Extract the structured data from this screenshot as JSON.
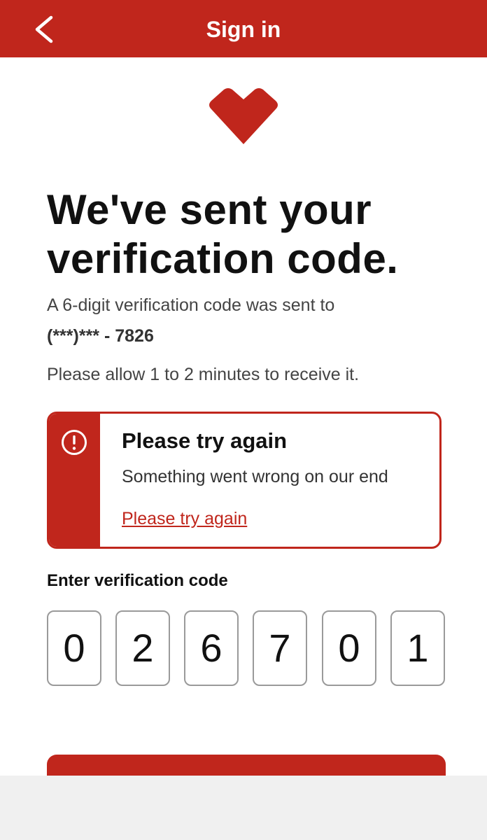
{
  "header": {
    "title": "Sign in"
  },
  "icons": {
    "back": "chevron-left-icon",
    "logo": "heart-icon",
    "alert": "exclamation-circle-icon"
  },
  "colors": {
    "brand": "#c0261c",
    "background": "#ffffff",
    "text": "#111111",
    "muted_text": "#444444",
    "digit_border": "#9a9a9a",
    "bottom_bar": "#f0f0f0"
  },
  "main": {
    "title": "We've sent your verification code.",
    "sent_text": "A 6-digit verification code was sent to",
    "phone": "(***)*** - 7826",
    "allow_text": "Please allow 1 to 2 minutes to receive it."
  },
  "alert": {
    "title": "Please try again",
    "message": "Something went wrong on our end",
    "link": "Please try again"
  },
  "code": {
    "label": "Enter verification code",
    "digits": [
      "0",
      "2",
      "6",
      "7",
      "0",
      "1"
    ]
  }
}
